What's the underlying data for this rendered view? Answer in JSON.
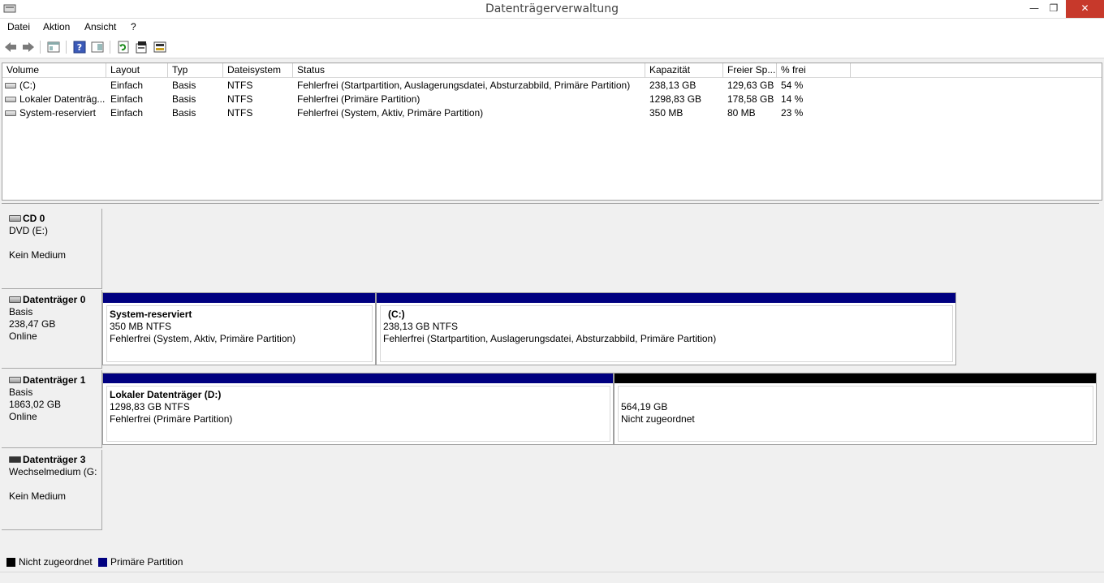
{
  "window": {
    "title": "Datenträgerverwaltung"
  },
  "menu": [
    "Datei",
    "Aktion",
    "Ansicht",
    "?"
  ],
  "toolbar": {
    "icons": [
      "back-arrow-icon",
      "forward-arrow-icon",
      "console-tree-icon",
      "help-icon",
      "panel-icon",
      "refresh-icon",
      "properties-icon",
      "rescan-icon"
    ]
  },
  "volumes": {
    "columns": [
      "Volume",
      "Layout",
      "Typ",
      "Dateisystem",
      "Status",
      "Kapazität",
      "Freier Sp...",
      "% frei"
    ],
    "rows": [
      {
        "volume": "(C:)",
        "layout": "Einfach",
        "typ": "Basis",
        "fs": "NTFS",
        "status": "Fehlerfrei (Startpartition, Auslagerungsdatei, Absturzabbild, Primäre Partition)",
        "kapazitaet": "238,13 GB",
        "frei": "129,63 GB",
        "pct": "54 %"
      },
      {
        "volume": "Lokaler Datenträg...",
        "layout": "Einfach",
        "typ": "Basis",
        "fs": "NTFS",
        "status": "Fehlerfrei (Primäre Partition)",
        "kapazitaet": "1298,83 GB",
        "frei": "178,58 GB",
        "pct": "14 %"
      },
      {
        "volume": "System-reserviert",
        "layout": "Einfach",
        "typ": "Basis",
        "fs": "NTFS",
        "status": "Fehlerfrei (System, Aktiv, Primäre Partition)",
        "kapazitaet": "350 MB",
        "frei": "80 MB",
        "pct": "23 %"
      }
    ]
  },
  "disks": {
    "cd0": {
      "name": "CD 0",
      "line1": "DVD (E:)",
      "line3": "Kein Medium"
    },
    "disk0": {
      "name": "Datenträger 0",
      "line1": "Basis",
      "line2": "238,47 GB",
      "line3": "Online",
      "partitions": [
        {
          "name": "System-reserviert",
          "size": "350 MB NTFS",
          "status": "Fehlerfrei (System, Aktiv, Primäre Partition)"
        },
        {
          "name": "(C:)",
          "size": "238,13 GB NTFS",
          "status": "Fehlerfrei (Startpartition, Auslagerungsdatei, Absturzabbild, Primäre Partition)"
        }
      ]
    },
    "disk1": {
      "name": "Datenträger 1",
      "line1": "Basis",
      "line2": "1863,02 GB",
      "line3": "Online",
      "partitions": [
        {
          "name": "Lokaler Datenträger  (D:)",
          "size": "1298,83 GB NTFS",
          "status": "Fehlerfrei (Primäre Partition)"
        },
        {
          "name": "",
          "size": "564,19 GB",
          "status": "Nicht zugeordnet"
        }
      ]
    },
    "disk3": {
      "name": "Datenträger 3",
      "line1": "Wechselmedium (G:",
      "line3": "Kein Medium"
    }
  },
  "legend": {
    "unallocated": "Nicht zugeordnet",
    "primary": "Primäre Partition"
  },
  "colors": {
    "primary": "#000080",
    "unallocated": "#000000",
    "close": "#c7392b"
  }
}
